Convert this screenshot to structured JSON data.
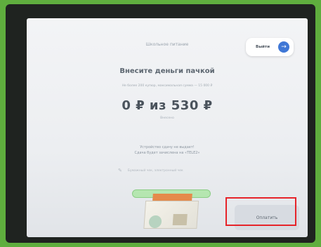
{
  "header": {
    "title": "Школьное питание",
    "exit_label": "Выйти",
    "exit_icon": "arrow-right-icon"
  },
  "payment": {
    "title": "Внесите деньги пачкой",
    "limit_text": "Не более 200 купюр, максимальная сумма — 15 000 ₽",
    "amount_display": "0 ₽ из 530 ₽",
    "amount_caption": "Внесено",
    "notice_line1": "Устройство сдачу не выдает!",
    "notice_line2": "Сдача будет зачислена на «TELE2»",
    "receipt_text": "Бумажный чек, электронный чек"
  },
  "actions": {
    "pay_label": "Оплатить"
  },
  "colors": {
    "background": "#5fae3e",
    "exit_icon": "#3f77d6",
    "highlight": "#e6242a"
  }
}
